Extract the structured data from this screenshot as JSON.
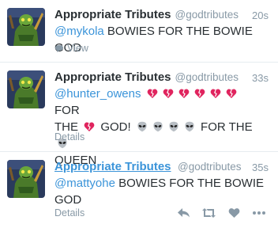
{
  "tweets": [
    {
      "name": "Appropriate Tributes",
      "handle": "@godtributes",
      "time": "20s",
      "mention": "@mykola",
      "text": "BOWIES FOR THE BOWIE GOD",
      "footer": "View"
    },
    {
      "name": "Appropriate Tributes",
      "handle": "@godtributes",
      "time": "33s",
      "mention": "@hunter_owens",
      "text_for": "FOR",
      "text_the": "THE",
      "text_god": "GOD!",
      "text_forthe": "FOR THE",
      "text_queen": "QUEEN",
      "footer": "Details",
      "emoji_primary": "broken-heart-icon",
      "emoji_secondary": "alien-icon"
    },
    {
      "name": "Appropriate Tributes",
      "handle": "@godtributes",
      "time": "35s",
      "mention": "@mattyohe",
      "text": "BOWIES FOR THE BOWIE GOD",
      "footer": "Details",
      "actions": [
        "reply-icon",
        "retweet-icon",
        "like-icon",
        "more-icon"
      ]
    }
  ],
  "colors": {
    "link": "#3b94d9",
    "muted": "#8899a6",
    "text": "#292f33",
    "heart": "#e0245e"
  }
}
